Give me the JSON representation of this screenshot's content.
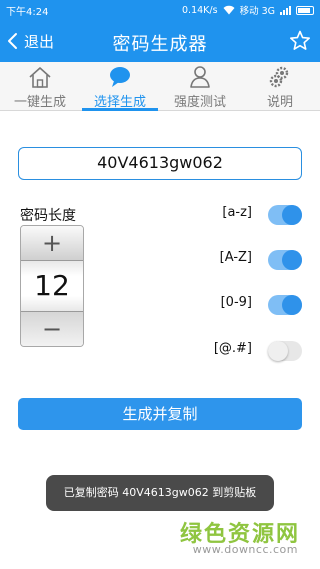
{
  "status_bar": {
    "time": "下午4:24",
    "net_speed": "0.14K/s",
    "carrier": "移动 3G"
  },
  "header": {
    "back_label": "退出",
    "title": "密码生成器",
    "accent_color": "#1f93ee"
  },
  "tabs": [
    {
      "label": "一键生成",
      "icon": "home-icon",
      "active": false
    },
    {
      "label": "选择生成",
      "icon": "chat-bubble-icon",
      "active": true
    },
    {
      "label": "强度测试",
      "icon": "person-icon",
      "active": false
    },
    {
      "label": "说明",
      "icon": "gears-icon",
      "active": false
    }
  ],
  "password": {
    "value": "40V4613gw062"
  },
  "length": {
    "label": "密码长度",
    "value": "12",
    "plus_glyph": "+",
    "minus_glyph": "−"
  },
  "options": [
    {
      "label": "[a-z]",
      "enabled": true
    },
    {
      "label": "[A-Z]",
      "enabled": true
    },
    {
      "label": "[0-9]",
      "enabled": true
    },
    {
      "label": "[@.#]",
      "enabled": false
    }
  ],
  "generate_button": {
    "label": "生成并复制"
  },
  "toast": {
    "text": "已复制密码 40V4613gw062 到剪贴板"
  },
  "watermark": {
    "title": "绿色资源网",
    "url": "www.downcc.com"
  }
}
